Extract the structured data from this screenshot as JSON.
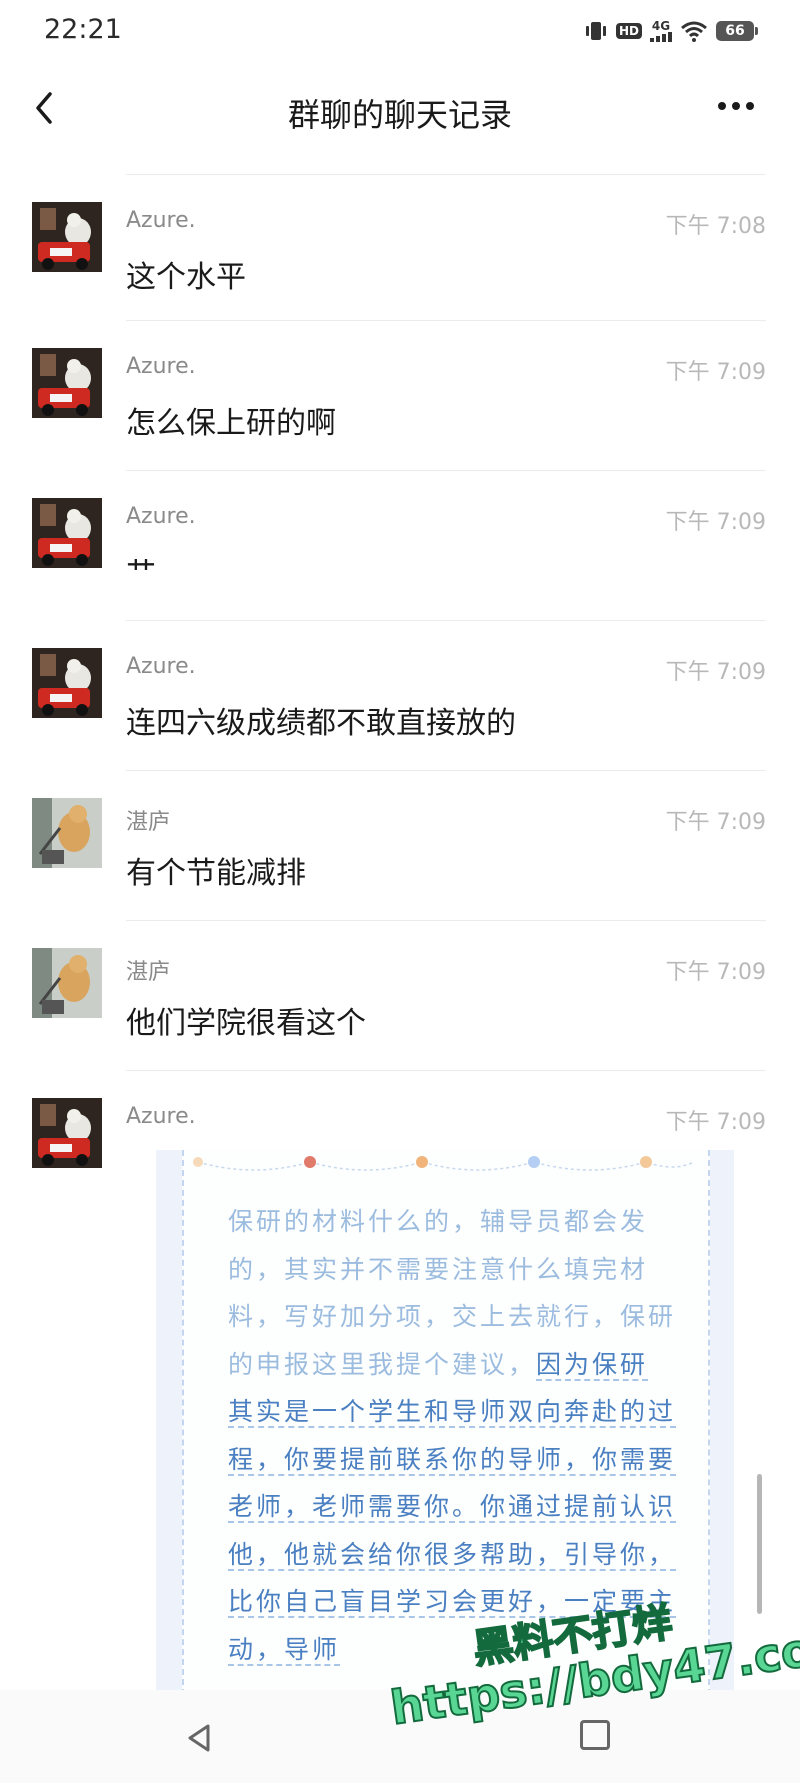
{
  "status_bar": {
    "time": "22:21",
    "hd_label": "HD",
    "network_label": "4G",
    "battery": "66"
  },
  "header": {
    "title": "群聊的聊天记录",
    "back_icon": "chevron-left-icon",
    "more_icon": "more-dots-icon"
  },
  "messages": [
    {
      "sender": "Azure.",
      "time": "下午 7:08",
      "text": "这个水平"
    },
    {
      "sender": "Azure.",
      "time": "下午 7:09",
      "text": "怎么保上研的啊"
    },
    {
      "sender": "Azure.",
      "time": "下午 7:09",
      "text": "艹"
    },
    {
      "sender": "Azure.",
      "time": "下午 7:09",
      "text": "连四六级成绩都不敢直接放的"
    },
    {
      "sender": "湛庐",
      "time": "下午 7:09",
      "text": "有个节能减排"
    },
    {
      "sender": "湛庐",
      "time": "下午 7:09",
      "text": "他们学院很看这个"
    },
    {
      "sender": "Azure.",
      "time": "下午 7:09",
      "text": ""
    }
  ],
  "image_message": {
    "plain_text": "保研的材料什么的，辅导员都会发的，其实并不需要注意什么填完材料，写好加分项，交上去就行，保研的申报这里我提个建议，",
    "highlight_text": "因为保研其实是一个学生和导师双向奔赴的过程，你要提前联系你的导师，你需要老师，老师需要你。你通过提前认识他，他就会给你很多帮助，引导你，比你自己盲目学习会更好，一定要主动，导师"
  },
  "watermark": {
    "line1": "黑料不打烊",
    "line2": "https://bdy47.co"
  },
  "colors": {
    "accent_blue": "#4a7fc1",
    "light_blue_text": "#9cbcdf",
    "watermark_green": "#59d694"
  }
}
